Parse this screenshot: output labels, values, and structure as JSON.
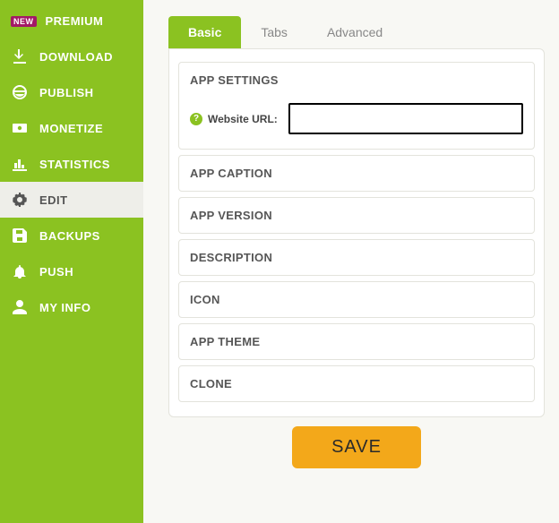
{
  "sidebar": {
    "new_badge": "NEW",
    "items": [
      {
        "label": "PREMIUM",
        "icon": "star-icon",
        "badge": true
      },
      {
        "label": "DOWNLOAD",
        "icon": "download-icon"
      },
      {
        "label": "PUBLISH",
        "icon": "globe-icon"
      },
      {
        "label": "MONETIZE",
        "icon": "money-icon"
      },
      {
        "label": "STATISTICS",
        "icon": "chart-icon"
      },
      {
        "label": "EDIT",
        "icon": "gears-icon",
        "active": true
      },
      {
        "label": "BACKUPS",
        "icon": "save-icon"
      },
      {
        "label": "PUSH",
        "icon": "bell-icon"
      },
      {
        "label": "MY INFO",
        "icon": "user-icon"
      }
    ]
  },
  "tabs": [
    {
      "label": "Basic",
      "active": true
    },
    {
      "label": "Tabs"
    },
    {
      "label": "Advanced"
    }
  ],
  "sections": {
    "app_settings": {
      "title": "APP SETTINGS",
      "help_glyph": "?",
      "url_label": "Website URL:",
      "url_value": ""
    },
    "caption": {
      "title": "APP CAPTION"
    },
    "version": {
      "title": "APP VERSION"
    },
    "description": {
      "title": "DESCRIPTION"
    },
    "icon": {
      "title": "ICON"
    },
    "theme": {
      "title": "APP THEME"
    },
    "clone": {
      "title": "CLONE"
    }
  },
  "save_label": "SAVE"
}
